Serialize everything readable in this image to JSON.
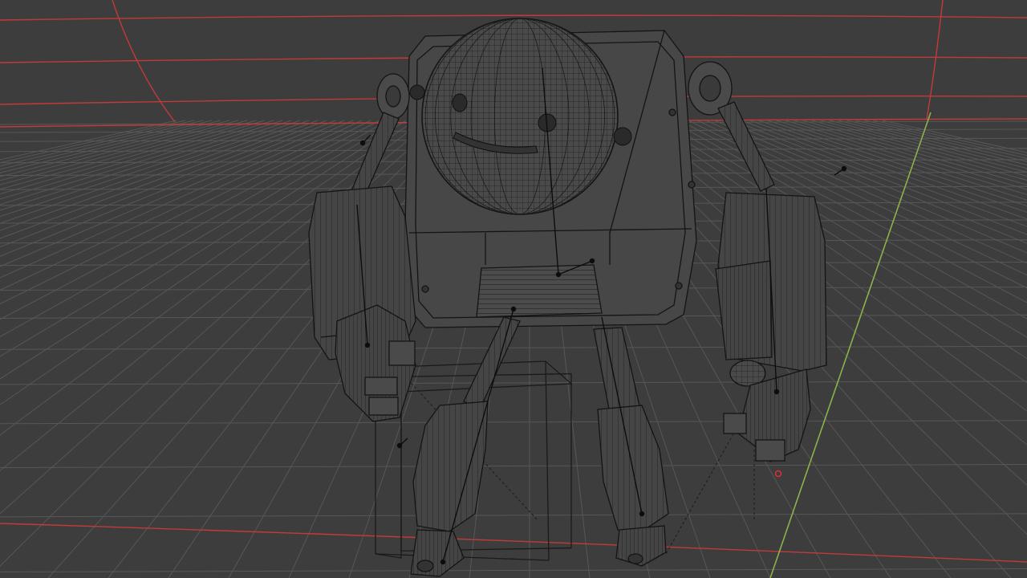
{
  "viewport": {
    "mode": "wireframe",
    "background": "#3d3d3d",
    "grid_color": "#555555",
    "x_axis_color": "#c23a3a",
    "y_axis_color": "#8ab34a",
    "wire_color": "#141414",
    "origin_marker_color": "#e03030"
  },
  "scene": {
    "objects": [
      {
        "name": "robot-head-sphere",
        "type": "mesh"
      },
      {
        "name": "robot-body",
        "type": "mesh"
      },
      {
        "name": "left-arm",
        "type": "mesh"
      },
      {
        "name": "right-arm",
        "type": "mesh"
      },
      {
        "name": "left-leg",
        "type": "mesh"
      },
      {
        "name": "right-leg",
        "type": "mesh"
      },
      {
        "name": "cube",
        "type": "mesh"
      },
      {
        "name": "armature",
        "type": "bones"
      }
    ]
  }
}
